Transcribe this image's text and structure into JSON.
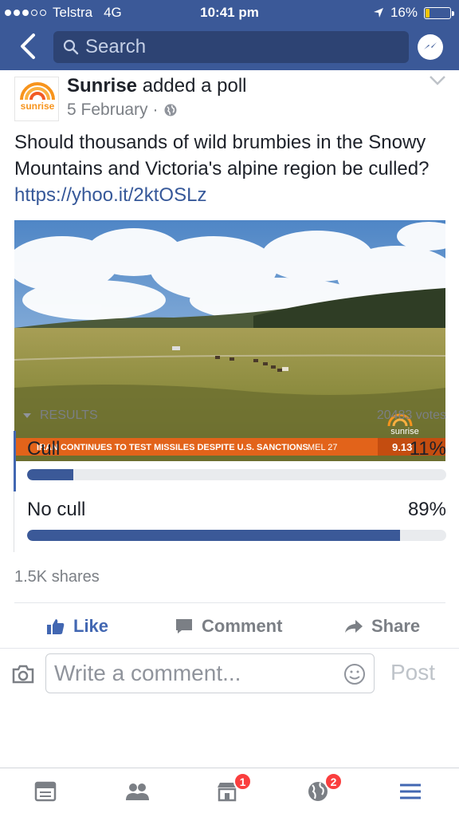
{
  "status_bar": {
    "carrier": "Telstra",
    "network": "4G",
    "time": "10:41 pm",
    "battery": "16%"
  },
  "nav": {
    "search_placeholder": "Search"
  },
  "post": {
    "author": "Sunrise",
    "action": "added a poll",
    "date": "5 February",
    "text": "Should thousands of wild brumbies in the Snowy Mountains and Victoria's alpine region be culled?",
    "link": "https://yhoo.it/2ktOSLz",
    "photo": {
      "ticker": "IRAN CONTINUES TO TEST MISSILES DESPITE U.S. SANCTIONS",
      "weather": "MEL 27",
      "clock": "9.13",
      "watermark": "sunrise"
    },
    "avatar_logo": "sunrise"
  },
  "poll": {
    "results_label": "RESULTS",
    "votes": "20483 votes",
    "options": [
      {
        "label": "Cull",
        "percent_text": "11%",
        "percent": 11
      },
      {
        "label": "No cull",
        "percent_text": "89%",
        "percent": 89
      }
    ]
  },
  "shares": "1.5K shares",
  "actions": {
    "like": "Like",
    "comment": "Comment",
    "share": "Share"
  },
  "comment_bar": {
    "placeholder": "Write a comment...",
    "post": "Post"
  },
  "tabbar": {
    "marketplace_badge": "1",
    "notifications_badge": "2"
  },
  "colors": {
    "brand": "#3b5998",
    "link": "#365899",
    "badge": "#fa3e3e"
  }
}
